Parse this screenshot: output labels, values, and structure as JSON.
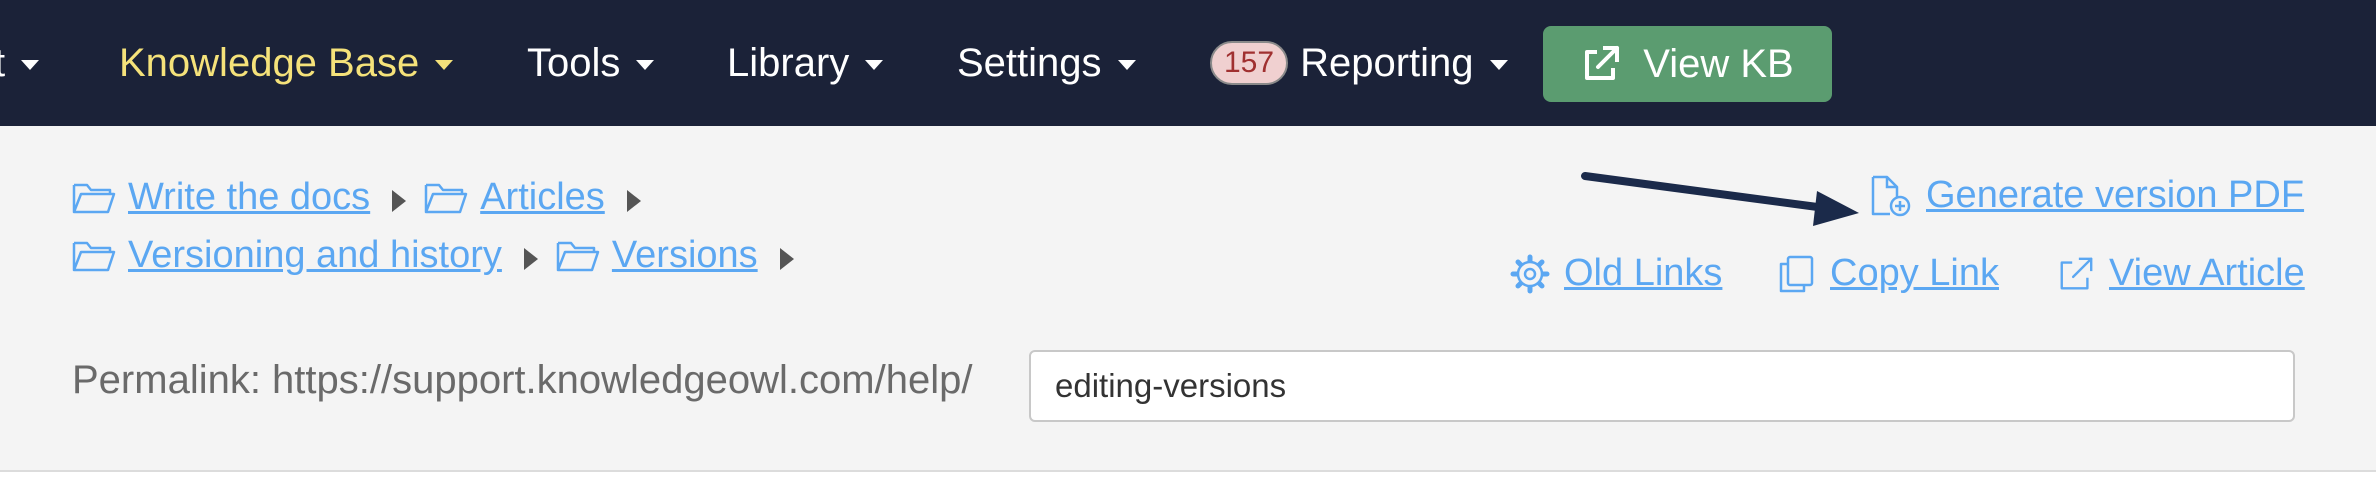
{
  "nav": {
    "items": [
      {
        "label": "t"
      },
      {
        "label": "Knowledge Base"
      },
      {
        "label": "Tools"
      },
      {
        "label": "Library"
      },
      {
        "label": "Settings"
      },
      {
        "label": "Reporting",
        "badge": "157"
      }
    ],
    "view_kb_label": "View KB",
    "colors": {
      "bg": "#1b2238",
      "active": "#f5e27a",
      "button": "#5b9c70"
    }
  },
  "breadcrumb": {
    "row1": [
      "Write the docs",
      "Articles"
    ],
    "row2": [
      "Versioning and history",
      "Versions"
    ]
  },
  "actions": {
    "generate_pdf": "Generate version PDF",
    "old_links": "Old Links",
    "copy_link": "Copy Link",
    "view_article": "View Article"
  },
  "permalink": {
    "label": "Permalink: https://support.knowledgeowl.com/help/",
    "value": "editing-versions"
  },
  "colors": {
    "link": "#5ba7f2",
    "arrow": "#1b2a4a"
  }
}
